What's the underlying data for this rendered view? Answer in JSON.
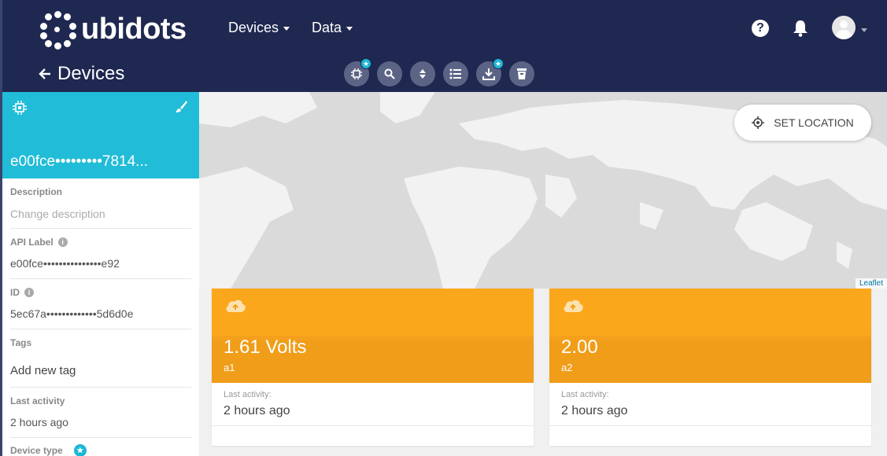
{
  "brand": {
    "name": "ubidots"
  },
  "nav": {
    "devices_label": "Devices",
    "data_label": "Data"
  },
  "subbar": {
    "title": "Devices"
  },
  "device": {
    "name": "e00fce•••••••••7814...",
    "fields": {
      "description_label": "Description",
      "description_value": "Change description",
      "api_label_label": "API Label",
      "api_label_value": "e00fce•••••••••••••••e92",
      "id_label": "ID",
      "id_value": "5ec67a•••••••••••••5d6d0e",
      "tags_label": "Tags",
      "tags_value": "Add new tag",
      "last_activity_label": "Last activity",
      "last_activity_value": "2 hours ago",
      "device_type_label": "Device type"
    }
  },
  "map": {
    "set_location_label": "SET LOCATION",
    "attribution": "Leaflet"
  },
  "cards": [
    {
      "value": "1.61 Volts",
      "label": "a1",
      "activity_label": "Last activity:",
      "activity_value": "2 hours ago"
    },
    {
      "value": "2.00",
      "label": "a2",
      "activity_label": "Last activity:",
      "activity_value": "2 hours ago"
    }
  ],
  "colors": {
    "nav_bg": "#1f2850",
    "device_header": "#21bcd7",
    "card_accent": "#fba71c",
    "badge": "#1bb7d6"
  }
}
